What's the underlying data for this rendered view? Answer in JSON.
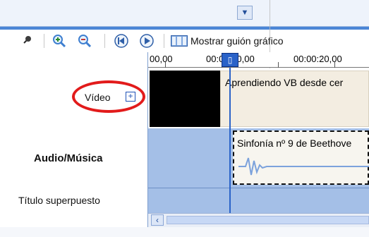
{
  "toolbar": {
    "dropdown_icon": "chevron-down-icon",
    "storyboard_label": "Mostrar guión gráfico"
  },
  "timeline": {
    "ruler_labels": [
      "00,00",
      "00:00:10,00",
      "00:00:20,00"
    ],
    "playhead_label": "00:00:10,00"
  },
  "tracks": {
    "video_label": "Vídeo",
    "audio_label": "Audio/Música",
    "title_label": "Título superpuesto"
  },
  "clips": {
    "video_title": "Aprendiendo VB desde cer",
    "audio_title": "Sinfonía nº 9 de Beethove"
  }
}
